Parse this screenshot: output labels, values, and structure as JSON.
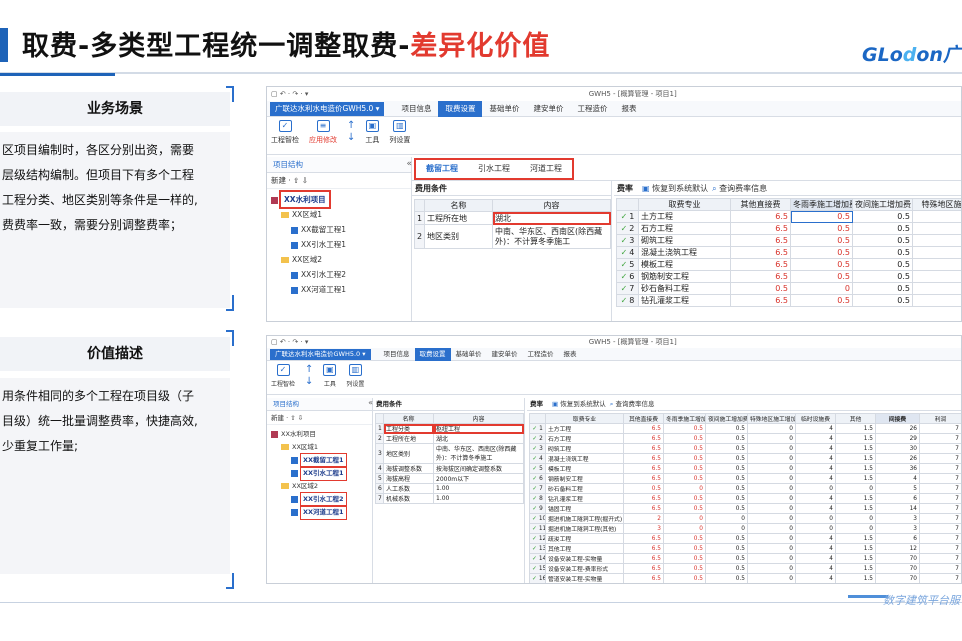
{
  "title": {
    "black": "取费-多类型工程统一调整取费-",
    "red": "差异化价值"
  },
  "logo": {
    "a": "GLo",
    "b": "d",
    "c": "on广"
  },
  "left": {
    "sec1_title": "业务场景",
    "sec1_lines": [
      "区项目编制时，各区分别出资，需要",
      "层级结构编制。但项目下有多个工程",
      "工程分类、地区类别等条件是一样的,",
      "费费率一致，需要分别调整费率；"
    ],
    "sec2_title": "价值描述",
    "sec2_lines": [
      "用条件相同的多个工程在项目级（子",
      "目级）统一批量调整费率，快捷高效,",
      "少重复工作量;"
    ]
  },
  "s1": {
    "window_title": "GWH5 - [概算管理 - 项目1]",
    "quick": "▢ ↶ · ↷ · ▾",
    "product": "广联达水利水电造价GWH5.0 ▾",
    "menu": [
      "项目信息",
      "取费设置",
      "基础单价",
      "建安单价",
      "工程造价",
      "报表"
    ],
    "tools": [
      "工程智检",
      "应用修改",
      "",
      "工具",
      "列设置"
    ],
    "tree_title": "项目结构",
    "tree_new": "新建 · ⇧ ⇩",
    "tree_root": "XX水利项目",
    "tree": [
      {
        "t": "XX区域1",
        "k": "f",
        "d": 1
      },
      {
        "t": "XX截留工程1",
        "k": "p",
        "d": 2
      },
      {
        "t": "XX引水工程1",
        "k": "p",
        "d": 2
      },
      {
        "t": "XX区域2",
        "k": "f",
        "d": 1
      },
      {
        "t": "XX引水工程2",
        "k": "p",
        "d": 2
      },
      {
        "t": "XX河道工程1",
        "k": "p",
        "d": 2
      }
    ],
    "tabs": [
      "截留工程",
      "引水工程",
      "河道工程"
    ],
    "cond_title": "费用条件",
    "cond_head": [
      "",
      "名称",
      "内容"
    ],
    "cond_rows": [
      [
        "1",
        "工程所在地",
        "湖北"
      ],
      [
        "2",
        "地区类别",
        "中南、华东区、西南区(除西藏外)：不计算冬季施工"
      ]
    ],
    "rate_title": "费率",
    "rate_reset": "恢复到系统默认",
    "rate_query": "查询费率信息",
    "rate_head": [
      "",
      "取费专业",
      "其他直接费",
      "冬雨季施工增加费",
      "夜间施工增加费",
      "特殊地区施工增"
    ],
    "rate_rows": [
      [
        "1",
        "土方工程",
        "6.5",
        "0.5",
        "0.5"
      ],
      [
        "2",
        "石方工程",
        "6.5",
        "0.5",
        "0.5"
      ],
      [
        "3",
        "砌筑工程",
        "6.5",
        "0.5",
        "0.5"
      ],
      [
        "4",
        "混凝土浇筑工程",
        "6.5",
        "0.5",
        "0.5"
      ],
      [
        "5",
        "模板工程",
        "6.5",
        "0.5",
        "0.5"
      ],
      [
        "6",
        "钢筋制安工程",
        "6.5",
        "0.5",
        "0.5"
      ],
      [
        "7",
        "砂石备料工程",
        "0.5",
        "0",
        "0.5"
      ],
      [
        "8",
        "钻孔灌浆工程",
        "6.5",
        "0.5",
        "0.5"
      ]
    ]
  },
  "s2": {
    "window_title": "GWH5 - [概算管理 - 项目1]",
    "product": "广联达水利水电造价GWH5.0 ▾",
    "menu": [
      "项目信息",
      "取费设置",
      "基础单价",
      "建安单价",
      "工程造价",
      "报表"
    ],
    "tools": [
      "工程智检",
      "",
      "工具",
      "列设置"
    ],
    "tree_title": "项目结构",
    "tree_new": "新建 · ⇧ ⇩",
    "tree_root": "XX水利项目",
    "tree": [
      {
        "t": "XX区域1",
        "k": "f",
        "d": 1
      },
      {
        "t": "XX截留工程1",
        "k": "p",
        "d": 2,
        "sel": true
      },
      {
        "t": "XX引水工程1",
        "k": "p",
        "d": 2,
        "sel": true
      },
      {
        "t": "XX区域2",
        "k": "f",
        "d": 1
      },
      {
        "t": "XX引水工程2",
        "k": "p",
        "d": 2,
        "sel": true
      },
      {
        "t": "XX河道工程1",
        "k": "p",
        "d": 2,
        "sel": true
      }
    ],
    "cond_title": "费用条件",
    "cond_head": [
      "",
      "名称",
      "内容"
    ],
    "cond_rows": [
      [
        "1",
        "工程分类",
        "枢纽工程"
      ],
      [
        "2",
        "工程所在地",
        "湖北"
      ],
      [
        "3",
        "地区类别",
        "中南、华东区、西南区(除西藏外)：不计算冬季施工"
      ],
      [
        "4",
        "海拔调整系数",
        "按海拔区间确定调整系数"
      ],
      [
        "5",
        "海拔高程",
        "2000m以下"
      ],
      [
        "6",
        "人工系数",
        "1.00"
      ],
      [
        "7",
        "机械系数",
        "1.00"
      ]
    ],
    "rate_title": "费率",
    "rate_reset": "恢复到系统默认",
    "rate_query": "查询费率信息",
    "rate_head": [
      "",
      "取费专业",
      "其他直接费",
      "冬雨季施工增加费",
      "夜间施工增加费",
      "特殊地区施工增加费",
      "临时设施费",
      "其他",
      "间接费",
      "利润"
    ],
    "rate_rows": [
      [
        "1",
        "土方工程",
        "6.5",
        "0.5",
        "0.5",
        "0",
        "4",
        "1.5",
        "26",
        "7"
      ],
      [
        "2",
        "石方工程",
        "6.5",
        "0.5",
        "0.5",
        "0",
        "4",
        "1.5",
        "29",
        "7"
      ],
      [
        "3",
        "砌筑工程",
        "6.5",
        "0.5",
        "0.5",
        "0",
        "4",
        "1.5",
        "30",
        "7"
      ],
      [
        "4",
        "混凝土浇筑工程",
        "6.5",
        "0.5",
        "0.5",
        "0",
        "4",
        "1.5",
        "26",
        "7"
      ],
      [
        "5",
        "模板工程",
        "6.5",
        "0.5",
        "0.5",
        "0",
        "4",
        "1.5",
        "36",
        "7"
      ],
      [
        "6",
        "钢筋制安工程",
        "6.5",
        "0.5",
        "0.5",
        "0",
        "4",
        "1.5",
        "4",
        "7"
      ],
      [
        "7",
        "砂石备料工程",
        "0.5",
        "0",
        "0.5",
        "0",
        "0",
        "0",
        "5",
        "7"
      ],
      [
        "8",
        "钻孔灌浆工程",
        "6.5",
        "0.5",
        "0.5",
        "0",
        "4",
        "1.5",
        "6",
        "7"
      ],
      [
        "9",
        "锚固工程",
        "6.5",
        "0.5",
        "0.5",
        "0",
        "4",
        "1.5",
        "14",
        "7"
      ],
      [
        "10",
        "掘进机施工隧洞工程(掘开式)",
        "2",
        "0",
        "0",
        "0",
        "0",
        "0",
        "3",
        "7"
      ],
      [
        "11",
        "掘进机施工隧洞工程(其他)",
        "3",
        "0",
        "0",
        "0",
        "0",
        "0",
        "3",
        "7"
      ],
      [
        "12",
        "疏浚工程",
        "6.5",
        "0.5",
        "0.5",
        "0",
        "4",
        "1.5",
        "6",
        "7"
      ],
      [
        "13",
        "其他工程",
        "6.5",
        "0.5",
        "0.5",
        "0",
        "4",
        "1.5",
        "12",
        "7"
      ],
      [
        "14",
        "设备安装工程-实物量",
        "6.5",
        "0.5",
        "0.5",
        "0",
        "4",
        "1.5",
        "70",
        "7"
      ],
      [
        "15",
        "设备安装工程-费率形式",
        "6.5",
        "0.5",
        "0.5",
        "0",
        "4",
        "1.5",
        "70",
        "7"
      ],
      [
        "16",
        "管道安装工程-实物量",
        "6.5",
        "0.5",
        "0.5",
        "0",
        "4",
        "1.5",
        "70",
        "7"
      ],
      [
        "17",
        "管道安装工程-费率形式",
        "6.5",
        "0.5",
        "0.5",
        "0",
        "4",
        "1.5",
        "70",
        "7"
      ]
    ]
  },
  "footer": "数字建筑平台服"
}
